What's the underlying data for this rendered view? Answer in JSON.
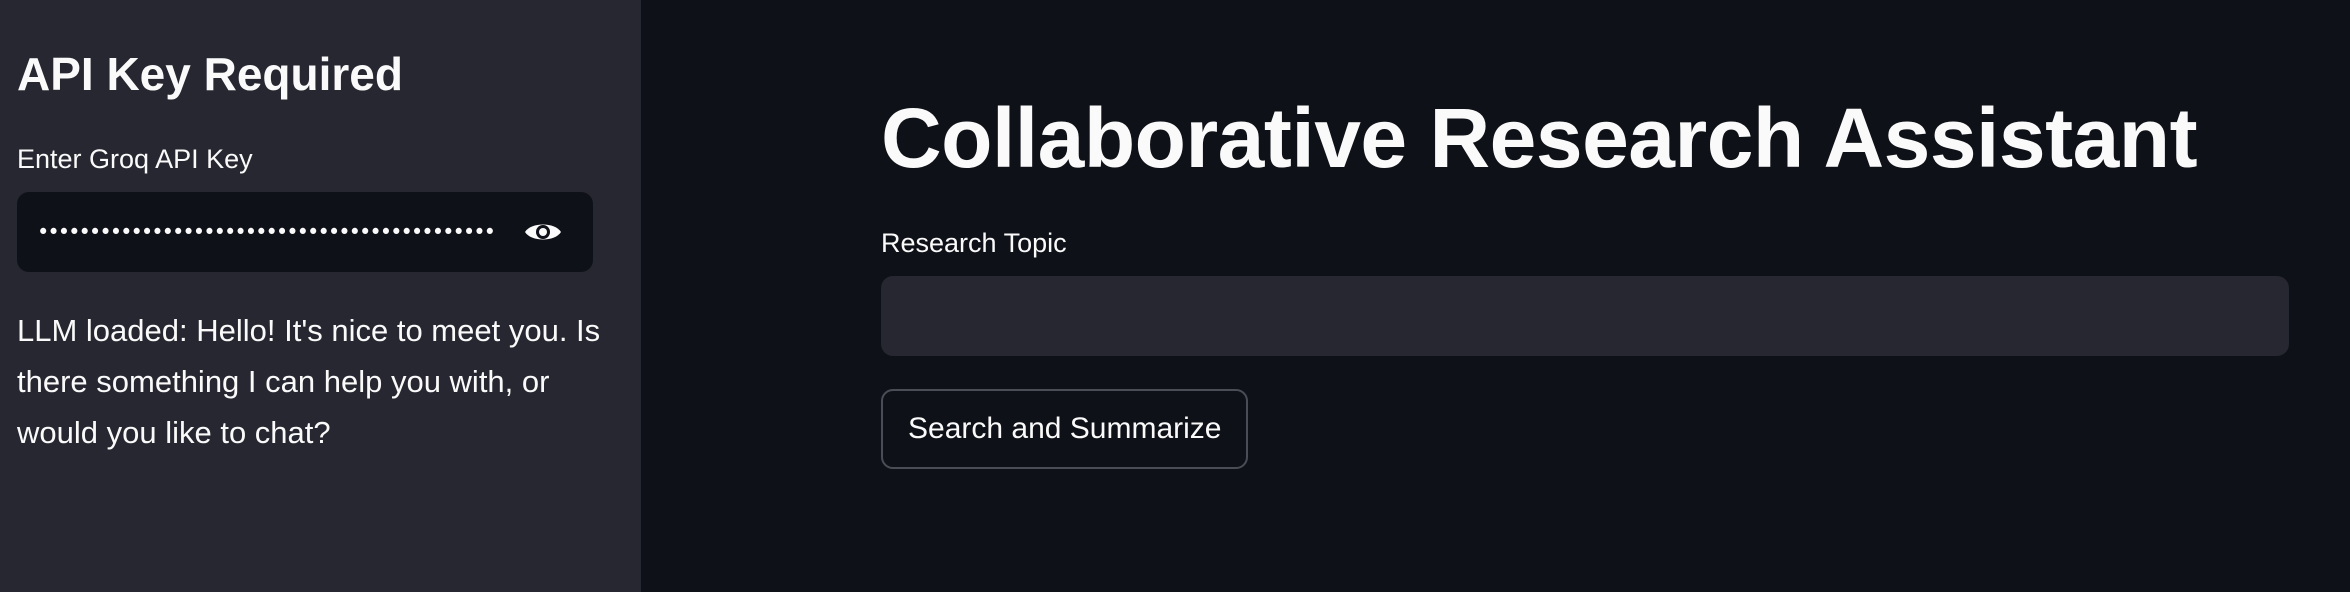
{
  "sidebar": {
    "heading": "API Key Required",
    "api_key": {
      "label": "Enter Groq API Key",
      "masked_value": "••••••••••••••••••••••••••••••••••••••••••••••••••••••••",
      "toggle_icon": "eye-icon"
    },
    "status_message": "LLM loaded: Hello! It's nice to meet you. Is there something I can help you with, or would you like to chat?"
  },
  "main": {
    "title": "Collaborative Research Assistant",
    "topic_field": {
      "label": "Research Topic",
      "value": ""
    },
    "submit_button_label": "Search and Summarize"
  },
  "colors": {
    "sidebar_bg": "#262730",
    "main_bg": "#0e1117",
    "input_bg": "#262730",
    "text": "#fafafa",
    "button_border": "#4a4d56"
  }
}
